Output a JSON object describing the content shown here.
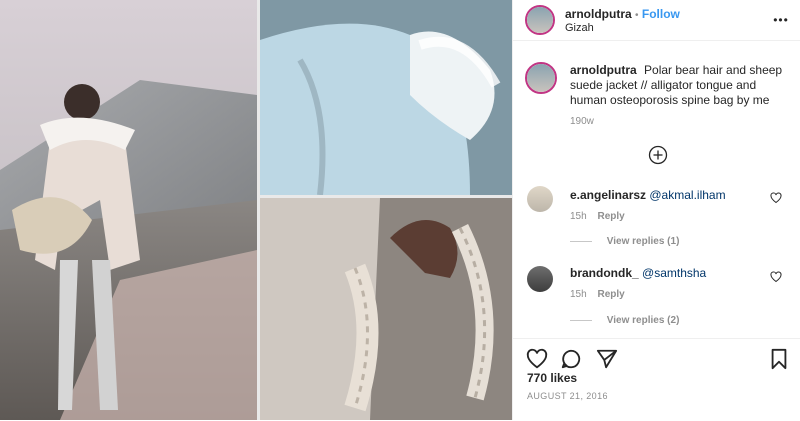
{
  "post": {
    "username": "arnoldputra",
    "follow_label": "Follow",
    "location": "Gizah",
    "caption": "Polar bear hair and sheep suede jacket // alligator tongue and human osteoporosis spine bag by me",
    "caption_time": "190w",
    "likes": "770 likes",
    "date": "AUGUST 21, 2016",
    "more_label": "•••"
  },
  "comments": [
    {
      "username": "e.angelinarsz",
      "text": "@akmal.ilham",
      "time": "15h",
      "reply": "Reply",
      "view_replies": "View replies (1)"
    },
    {
      "username": "brandondk_",
      "text": "@samthsha",
      "time": "15h",
      "reply": "Reply",
      "view_replies": "View replies (2)"
    }
  ],
  "icons": {
    "load_more": "plus-circle-icon",
    "like": "heart-icon",
    "comment": "comment-icon",
    "share": "share-icon",
    "save": "bookmark-icon"
  },
  "colors": {
    "link": "#3897f0",
    "text": "#262626",
    "muted": "#8e8e8e",
    "story_ring": "#c13584"
  }
}
